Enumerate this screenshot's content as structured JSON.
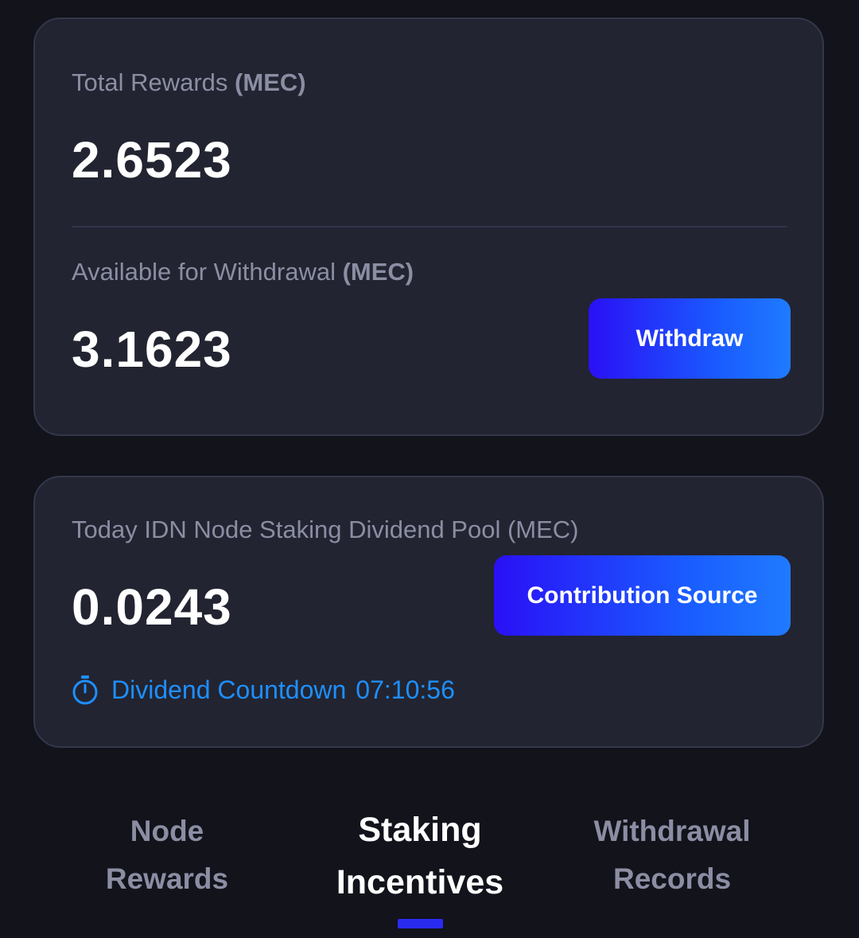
{
  "rewards_card": {
    "total_label": "Total Rewards",
    "total_unit": "(MEC)",
    "total_value": "2.6523",
    "available_label": "Available for Withdrawal",
    "available_unit": "(MEC)",
    "available_value": "3.1623",
    "withdraw_button": "Withdraw"
  },
  "pool_card": {
    "label": "Today IDN Node Staking Dividend Pool (MEC)",
    "value": "0.0243",
    "source_button": "Contribution Source",
    "countdown_icon": "stopwatch-icon",
    "countdown_label": "Dividend Countdown",
    "countdown_time": "07:10:56"
  },
  "tabs": [
    {
      "line1": "Node",
      "line2": "Rewards",
      "active": false
    },
    {
      "line1": "Staking",
      "line2": "Incentives",
      "active": true
    },
    {
      "line1": "Withdrawal",
      "line2": "Records",
      "active": false
    }
  ],
  "colors": {
    "background": "#12131b",
    "card": "#222431",
    "accent_blue": "#1e8fff",
    "button_gradient_start": "#2a10f6",
    "button_gradient_end": "#1f7bff",
    "muted_text": "#8b8ea3"
  }
}
